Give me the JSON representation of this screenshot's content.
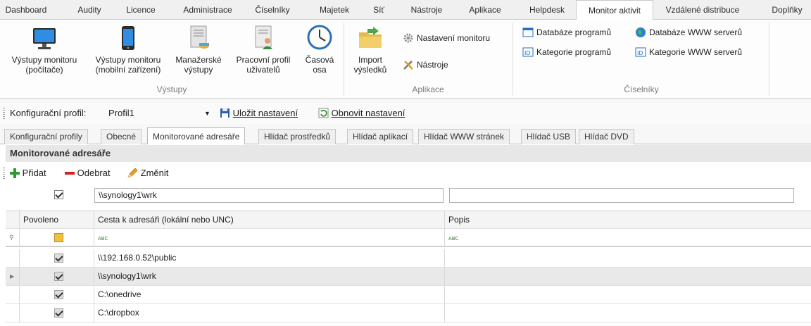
{
  "ribbon_tabs": [
    {
      "label": "Dashboard",
      "active": false
    },
    {
      "label": "Audity",
      "active": false
    },
    {
      "label": "Licence",
      "active": false
    },
    {
      "label": "Administrace",
      "active": false
    },
    {
      "label": "Číselníky",
      "active": false
    },
    {
      "label": "Majetek",
      "active": false
    },
    {
      "label": "Síť",
      "active": false
    },
    {
      "label": "Nástroje",
      "active": false
    },
    {
      "label": "Aplikace",
      "active": false
    },
    {
      "label": "Helpdesk",
      "active": false
    },
    {
      "label": "Monitor aktivit",
      "active": true
    },
    {
      "label": "Vzdálené distribuce",
      "active": false
    },
    {
      "label": "Doplňky",
      "active": false
    }
  ],
  "ribbon": {
    "vystupy": {
      "label": "Výstupy",
      "buttons": [
        {
          "label": "Výstupy monitoru\n(počítače)",
          "icon": "monitor-icon"
        },
        {
          "label": "Výstupy monitoru\n(mobilní zařízení)",
          "icon": "mobile-icon"
        },
        {
          "label": "Manažerské\nvýstupy",
          "icon": "report-icon"
        },
        {
          "label": "Pracovní profil\nuživatelů",
          "icon": "user-profile-icon"
        },
        {
          "label": "Časová\nosa",
          "icon": "clock-icon"
        }
      ]
    },
    "aplikace": {
      "label": "Aplikace",
      "import_label": "Import\nvýsledků",
      "settings_label": "Nastavení monitoru",
      "tools_label": "Nástroje"
    },
    "ciselniky": {
      "label": "Číselníky",
      "items": [
        "Databáze programů",
        "Databáze WWW serverů",
        "Kategorie programů",
        "Kategorie WWW serverů"
      ]
    }
  },
  "config": {
    "label": "Konfigurační profil:",
    "profile": "Profil1",
    "save_label": "Uložit nastavení",
    "restore_label": "Obnovit nastavení"
  },
  "page_tabs": [
    {
      "label": "Konfigurační profily",
      "active": false
    },
    {
      "label": "Obecné",
      "active": false
    },
    {
      "label": "Monitorované adresáře",
      "active": true
    },
    {
      "label": "Hlídač prostředků",
      "active": false
    },
    {
      "label": "Hlídač aplikací",
      "active": false
    },
    {
      "label": "Hlídač WWW stránek",
      "active": false
    },
    {
      "label": "Hlídač USB",
      "active": false
    },
    {
      "label": "Hlídač DVD",
      "active": false
    }
  ],
  "panel": {
    "title": "Monitorované adresáře",
    "add_label": "Přidat",
    "remove_label": "Odebrat",
    "edit_label": "Změnit"
  },
  "edit_row": {
    "enabled": true,
    "path": "\\\\synology1\\wrk",
    "description": ""
  },
  "grid": {
    "columns": [
      "Povoleno",
      "Cesta k adresáři (lokální nebo UNC)",
      "Popis"
    ],
    "filter_icon": "ABC",
    "rows": [
      {
        "enabled": true,
        "path": "\\\\192.168.0.52\\public",
        "description": "",
        "selected": false
      },
      {
        "enabled": true,
        "path": "\\\\synology1\\wrk",
        "description": "",
        "selected": true
      },
      {
        "enabled": true,
        "path": "C:\\onedrive",
        "description": "",
        "selected": false
      },
      {
        "enabled": true,
        "path": "C:\\dropbox",
        "description": "",
        "selected": false
      }
    ]
  },
  "colors": {
    "add": "#2e9a2e",
    "remove": "#d42020",
    "edit": "#e8a020",
    "accent": "#1f6fc5"
  }
}
